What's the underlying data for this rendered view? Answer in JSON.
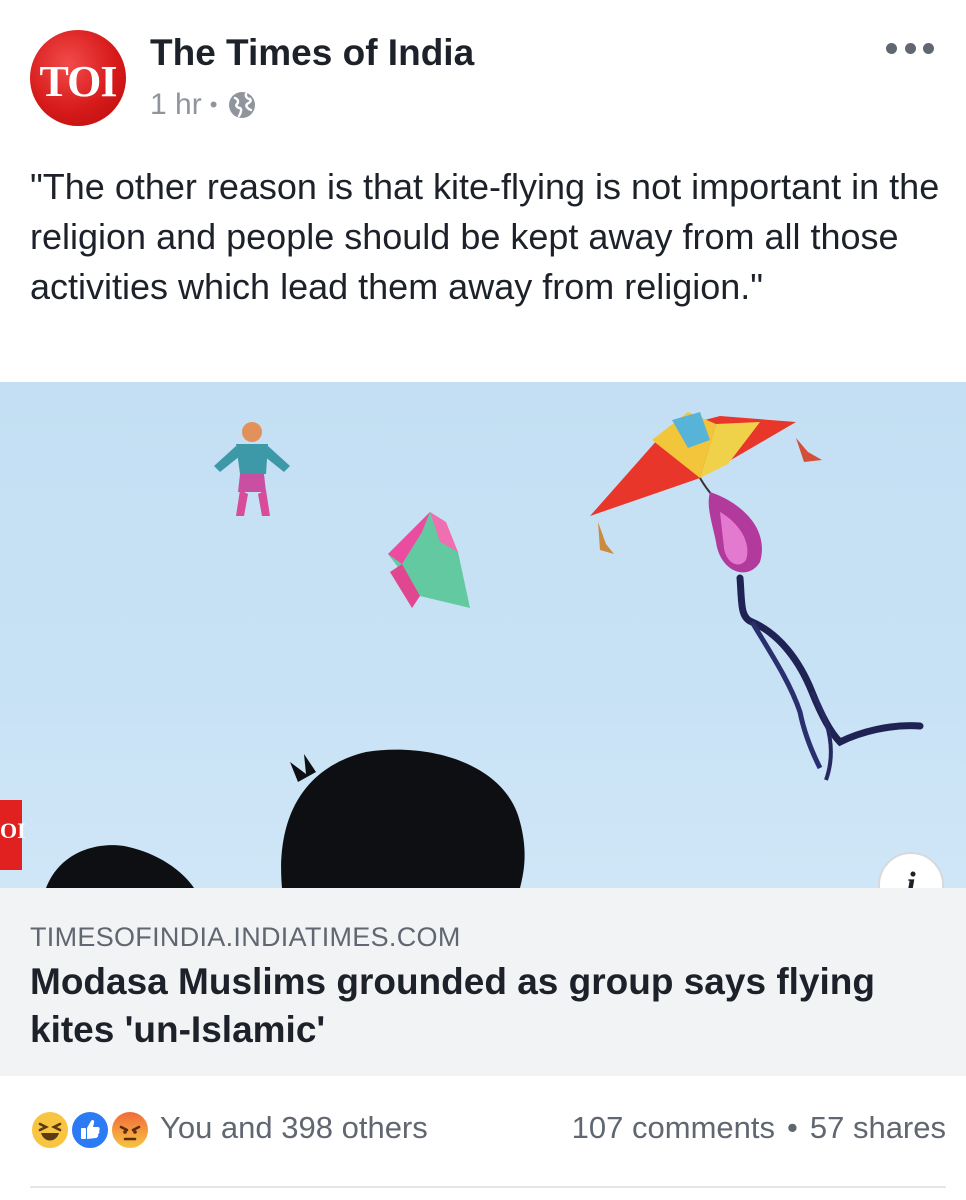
{
  "post": {
    "page_name": "The Times of India",
    "avatar_text": "TOI",
    "time": "1 hr",
    "privacy_icon": "globe-icon",
    "more_icon": "more-horizontal-icon",
    "message": "\"The other reason is that kite-flying is not important in the religion and people should be kept away from all those activities which lead them away from religion.\""
  },
  "link": {
    "image_alt": "Kites flying in a blue sky above silhouettes of heads",
    "watermark": "OI",
    "info_icon": "info-icon",
    "info_glyph": "i",
    "domain": "TIMESOFINDIA.INDIATIMES.COM",
    "title": "Modasa Muslims grounded as group says flying kites 'un-Islamic'"
  },
  "footer": {
    "reaction_icons": [
      "haha-icon",
      "like-icon",
      "angry-icon"
    ],
    "reactions_text": "You and 398 others",
    "comments": "107 comments",
    "separator": "•",
    "shares": "57 shares"
  },
  "colors": {
    "brand_red": "#d71a1a",
    "like_blue": "#2d7bf4",
    "haha_yellow": "#f7c541",
    "secondary_text": "#606770",
    "caption_bg": "#f2f3f5",
    "sky": "#c6e0f4"
  }
}
